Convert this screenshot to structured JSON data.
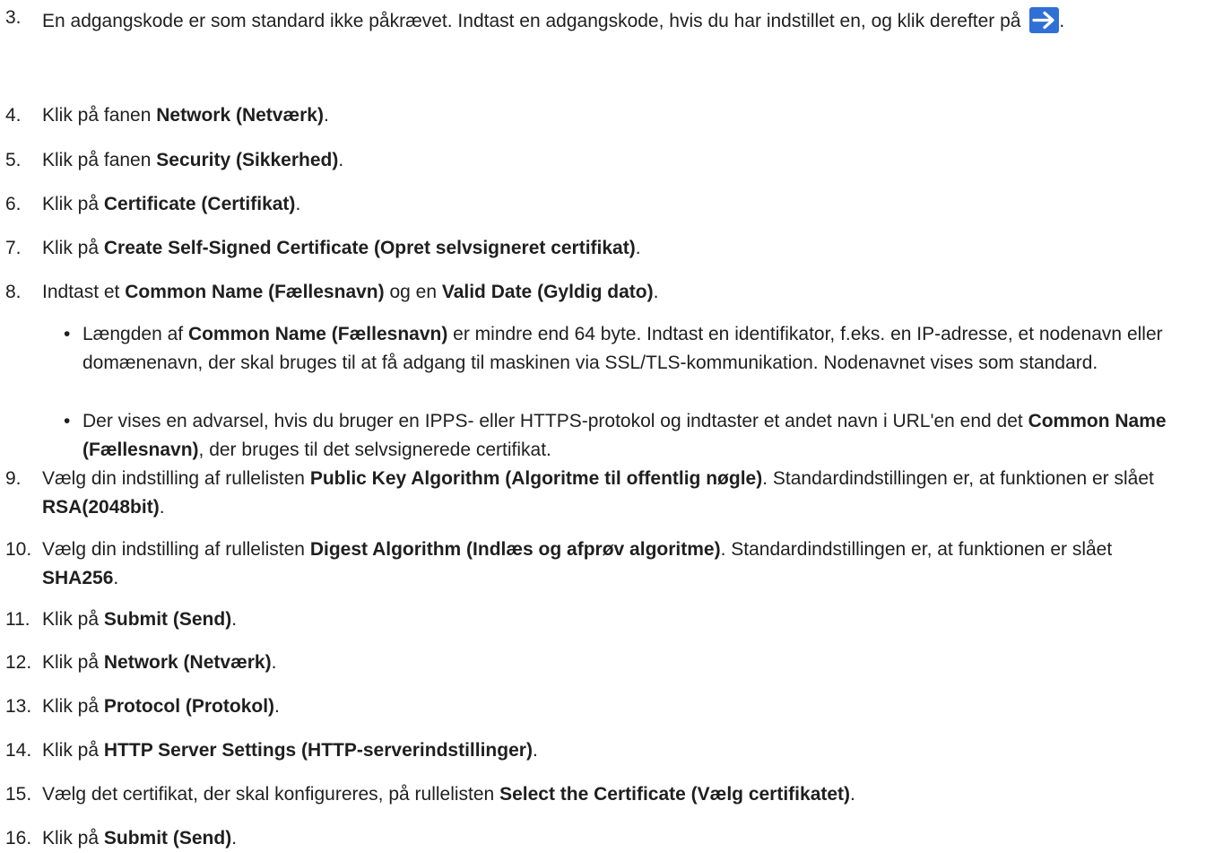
{
  "steps": [
    {
      "num": "3.",
      "parts": [
        {
          "t": "En adgangskode er som standard ikke påkrævet. Indtast en adgangskode, hvis du har indstillet en, og klik derefter på "
        },
        {
          "icon": "arrow-right-button"
        },
        {
          "t": "."
        }
      ]
    },
    {
      "num": "4.",
      "parts": [
        {
          "t": "Klik på fanen "
        },
        {
          "b": "Network (Netværk)"
        },
        {
          "t": "."
        }
      ]
    },
    {
      "num": "5.",
      "parts": [
        {
          "t": "Klik på fanen "
        },
        {
          "b": "Security (Sikkerhed)"
        },
        {
          "t": "."
        }
      ]
    },
    {
      "num": "6.",
      "parts": [
        {
          "t": "Klik på "
        },
        {
          "b": "Certificate (Certifikat)"
        },
        {
          "t": "."
        }
      ]
    },
    {
      "num": "7.",
      "parts": [
        {
          "t": "Klik på "
        },
        {
          "b": "Create Self-Signed Certificate (Opret selvsigneret certifikat)"
        },
        {
          "t": "."
        }
      ]
    },
    {
      "num": "8.",
      "parts": [
        {
          "t": "Indtast et "
        },
        {
          "b": "Common Name (Fællesnavn)"
        },
        {
          "t": " og en "
        },
        {
          "b": "Valid Date (Gyldig dato)"
        },
        {
          "t": "."
        }
      ]
    },
    {
      "num": "9.",
      "parts": [
        {
          "t": "Vælg din indstilling af rullelisten "
        },
        {
          "b": "Public Key Algorithm (Algoritme til offentlig nøgle)"
        },
        {
          "t": ". Standardindstillingen er, at funktionen er slået "
        },
        {
          "b": "RSA(2048bit)"
        },
        {
          "t": "."
        }
      ]
    },
    {
      "num": "10.",
      "parts": [
        {
          "t": "Vælg din indstilling af rullelisten "
        },
        {
          "b": "Digest Algorithm (Indlæs og afprøv algoritme)"
        },
        {
          "t": ". Standardindstillingen er, at funktionen er slået "
        },
        {
          "b": "SHA256"
        },
        {
          "t": "."
        }
      ]
    },
    {
      "num": "11.",
      "parts": [
        {
          "t": "Klik på "
        },
        {
          "b": "Submit (Send)"
        },
        {
          "t": "."
        }
      ]
    },
    {
      "num": "12.",
      "parts": [
        {
          "t": "Klik på "
        },
        {
          "b": "Network (Netværk)"
        },
        {
          "t": "."
        }
      ]
    },
    {
      "num": "13.",
      "parts": [
        {
          "t": "Klik på "
        },
        {
          "b": "Protocol (Protokol)"
        },
        {
          "t": "."
        }
      ]
    },
    {
      "num": "14.",
      "parts": [
        {
          "t": "Klik på "
        },
        {
          "b": "HTTP Server Settings (HTTP-serverindstillinger)"
        },
        {
          "t": "."
        }
      ]
    },
    {
      "num": "15.",
      "parts": [
        {
          "t": "Vælg det certifikat, der skal konfigureres, på rullelisten "
        },
        {
          "b": "Select the Certificate (Vælg certifikatet)"
        },
        {
          "t": "."
        }
      ]
    },
    {
      "num": "16.",
      "parts": [
        {
          "t": "Klik på "
        },
        {
          "b": "Submit (Send)"
        },
        {
          "t": "."
        }
      ]
    }
  ],
  "bullets": [
    {
      "dot": "•",
      "parts": [
        {
          "t": "Længden af "
        },
        {
          "b": "Common Name (Fællesnavn)"
        },
        {
          "t": " er mindre end 64 byte. Indtast en identifikator, f.eks. en IP-adresse, et nodenavn eller domænenavn, der skal bruges til at få adgang til maskinen via SSL/TLS-kommunikation. Nodenavnet vises som standard."
        }
      ]
    },
    {
      "dot": "•",
      "parts": [
        {
          "t": "Der vises en advarsel, hvis du bruger en IPPS- eller HTTPS-protokol og indtaster et andet navn i URL'en end det "
        },
        {
          "b": "Common Name (Fællesnavn)"
        },
        {
          "t": ", der bruges til det selvsignerede certifikat."
        }
      ]
    }
  ],
  "colors": {
    "text": "#1f1f1f",
    "arrow_button": "#2f6fd6"
  }
}
